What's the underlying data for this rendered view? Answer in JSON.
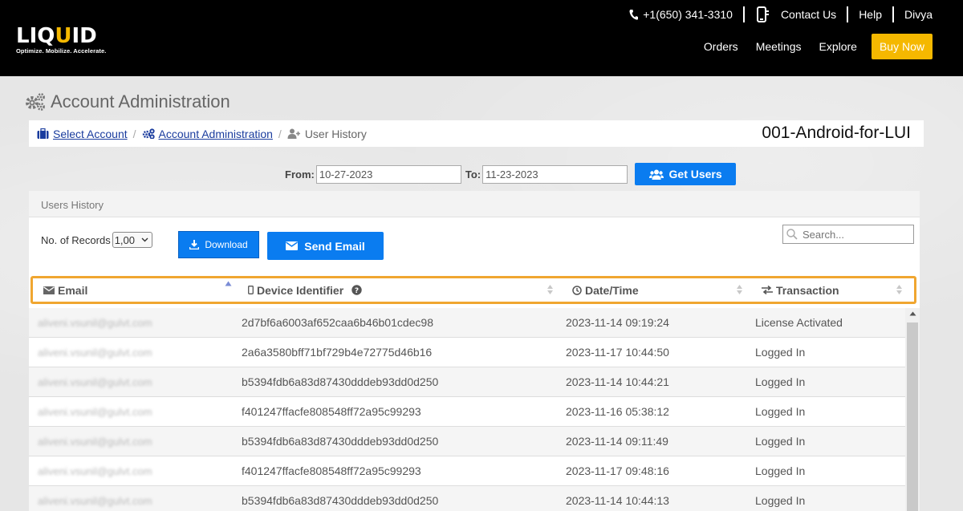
{
  "header": {
    "logo_text": "LIQUID",
    "logo_tagline": "Optimize. Mobilize. Accelerate.",
    "phone": "+1(650) 341-3310",
    "contact_label": "Contact Us",
    "help_label": "Help",
    "user_name": "Divya",
    "nav": [
      "Orders",
      "Meetings",
      "Explore"
    ],
    "buy_label": "Buy Now",
    "colors": {
      "bar": "#000000",
      "accent": "#f5b800"
    }
  },
  "page": {
    "title": "Account Administration",
    "breadcrumb": [
      {
        "label": "Select Account",
        "icon": "briefcase-icon"
      },
      {
        "label": "Account Administration",
        "icon": "gears-icon"
      },
      {
        "label": "User History",
        "icon": "user-plus-icon"
      }
    ],
    "account_id": "001-Android-for-LUI"
  },
  "filter": {
    "from_label": "From:",
    "from_value": "10-27-2023",
    "to_label": "To:",
    "to_value": "11-23-2023",
    "get_users_label": "Get Users"
  },
  "panel": {
    "title": "Users History",
    "records_label": "No. of Records",
    "records_value": "1,00",
    "download_label": "Download",
    "send_email_label": "Send Email",
    "search_placeholder": "Search..."
  },
  "table": {
    "columns": [
      "Email",
      "Device Identifier",
      "Date/Time",
      "Transaction"
    ],
    "rows": [
      {
        "email": "aliveni.vsunil@gulvt.com",
        "device": "2d7bf6a6003af652caa6b46b01cdec98",
        "date": "2023-11-14 09:19:24",
        "transaction": "License Activated"
      },
      {
        "email": "aliveni.vsunil@gulvt.com",
        "device": "2a6a3580bff71bf729b4e72775d46b16",
        "date": "2023-11-17 10:44:50",
        "transaction": "Logged In"
      },
      {
        "email": "aliveni.vsunil@gulvt.com",
        "device": "b5394fdb6a83d87430dddeb93dd0d250",
        "date": "2023-11-14 10:44:21",
        "transaction": "Logged In"
      },
      {
        "email": "aliveni.vsunil@gulvt.com",
        "device": "f401247ffacfe808548ff72a95c99293",
        "date": "2023-11-16 05:38:12",
        "transaction": "Logged In"
      },
      {
        "email": "aliveni.vsunil@gulvt.com",
        "device": "b5394fdb6a83d87430dddeb93dd0d250",
        "date": "2023-11-14 09:11:49",
        "transaction": "Logged In"
      },
      {
        "email": "aliveni.vsunil@gulvt.com",
        "device": "f401247ffacfe808548ff72a95c99293",
        "date": "2023-11-17 09:48:16",
        "transaction": "Logged In"
      },
      {
        "email": "aliveni.vsunil@gulvt.com",
        "device": "b5394fdb6a83d87430dddeb93dd0d250",
        "date": "2023-11-14 10:44:13",
        "transaction": "Logged In"
      }
    ]
  }
}
